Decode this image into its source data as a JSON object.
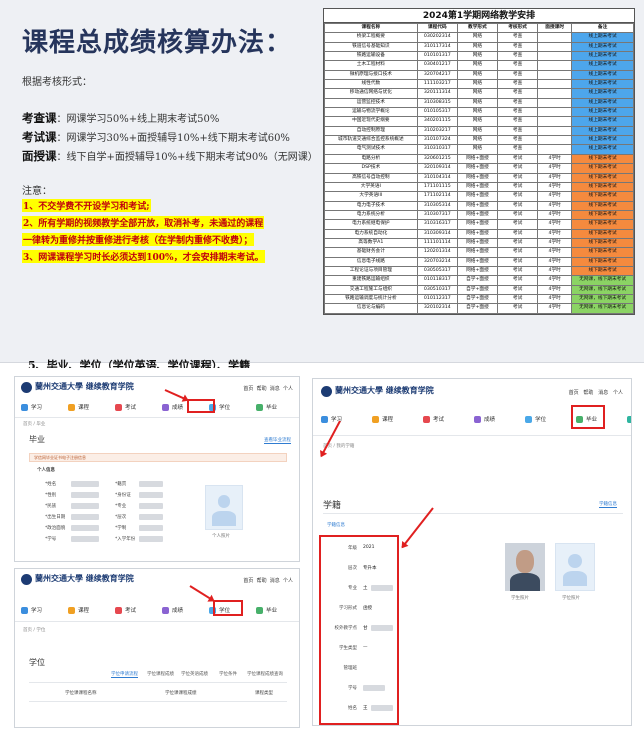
{
  "slide": {
    "title": "课程总成绩核算办法：",
    "subtitle": "根据考核形式：",
    "rules": [
      {
        "term": "考查课",
        "text": "：网课学习50%+线上期末考试50%"
      },
      {
        "term": "考试课",
        "text": "：网课学习30%+面授辅导10%+线下期末考试60%"
      },
      {
        "term": "面授课",
        "text": "：线下自学+面授辅导10%+线下期末考试90%（无网课）"
      }
    ],
    "note_label": "注意：",
    "highlights": [
      "1、不交学费不开设学习和考试;",
      "2、所有学期的视频教学全部开放，取消补考，未通过的课程",
      "一律转为重修并按重修进行考核（在学制内重修不收费）；",
      "3、网课课程学习时长必须达到100%，才会安排期末考试。"
    ]
  },
  "table": {
    "title": "2024第1学期网络教学安排",
    "headers": [
      "课程名称",
      "课程代码",
      "教学形式",
      "考核形式",
      "面授课时",
      "备注"
    ],
    "rows": [
      [
        "桥梁工程概要",
        "030202314",
        "网络",
        "考查",
        "",
        "线上期末考试",
        "blue"
      ],
      [
        "铁道信号基础知识",
        "310117314",
        "网络",
        "考查",
        "",
        "线上期末考试",
        "blue"
      ],
      [
        "铁路运输设备",
        "010101317",
        "网络",
        "考查",
        "",
        "线上期末考试",
        "blue"
      ],
      [
        "土木工程材料",
        "030401217",
        "网络",
        "考查",
        "",
        "线上期末考试",
        "blue"
      ],
      [
        "微机原理与接口技术",
        "320704217",
        "网络",
        "考查",
        "",
        "线上期末考试",
        "blue"
      ],
      [
        "线性代数",
        "111103217",
        "网络",
        "考查",
        "",
        "线上期末考试",
        "blue"
      ],
      [
        "移动通信网络与优化",
        "320111314",
        "网络",
        "考查",
        "",
        "线上期末考试",
        "blue"
      ],
      [
        "运营监控技术",
        "310308315",
        "网络",
        "考查",
        "",
        "线上期末考试",
        "blue"
      ],
      [
        "运输与物流学概论",
        "010105317",
        "网络",
        "考查",
        "",
        "线上期末考试",
        "blue"
      ],
      [
        "中国近现代史纲要",
        "340201115",
        "网络",
        "考查",
        "",
        "线上期末考试",
        "blue"
      ],
      [
        "自动控制原理",
        "310203217",
        "网络",
        "考查",
        "",
        "线上期末考试",
        "blue"
      ],
      [
        "城市轨道交通综合监控系统概述",
        "310107324",
        "网络",
        "考查",
        "",
        "线上期末考试",
        "blue"
      ],
      [
        "电气测试技术",
        "310310317",
        "网络",
        "考查",
        "",
        "线上期末考试",
        "blue"
      ],
      [
        "电路分析",
        "320601215",
        "网络+面授",
        "考试",
        "4学时",
        "线下期末考试",
        "orange"
      ],
      [
        "DSP技术",
        "320109314",
        "网络+面授",
        "考试",
        "4学时",
        "线下期末考试",
        "orange"
      ],
      [
        "高铁信号自动控制",
        "310104314",
        "网络+面授",
        "考试",
        "4学时",
        "线下期末考试",
        "orange"
      ],
      [
        "大学英语I",
        "171101115",
        "网络+面授",
        "考试",
        "4学时",
        "线下期末考试",
        "orange"
      ],
      [
        "大学英语III",
        "171102114",
        "网络+面授",
        "考试",
        "4学时",
        "线下期末考试",
        "orange"
      ],
      [
        "电力电子技术",
        "310305314",
        "网络+面授",
        "考试",
        "4学时",
        "线下期末考试",
        "orange"
      ],
      [
        "电力系统分析",
        "310307317",
        "网络+面授",
        "考试",
        "4学时",
        "线下期末考试",
        "orange"
      ],
      [
        "电力系统继电保护",
        "310316317",
        "网络+面授",
        "考试",
        "4学时",
        "线下期末考试",
        "orange"
      ],
      [
        "电力系统自动化",
        "310309314",
        "网络+面授",
        "考试",
        "4学时",
        "线下期末考试",
        "orange"
      ],
      [
        "高等数学A1",
        "111101114",
        "网络+面授",
        "考试",
        "4学时",
        "线下期末考试",
        "orange"
      ],
      [
        "基础财务会计",
        "120201314",
        "网络+面授",
        "考试",
        "4学时",
        "线下期末考试",
        "orange"
      ],
      [
        "信息电子线路",
        "320703214",
        "网络+面授",
        "考试",
        "4学时",
        "线下期末考试",
        "orange"
      ],
      [
        "工程论证与项目管理",
        "030505317",
        "网络+面授",
        "考试",
        "4学时",
        "线下期末考试",
        "orange"
      ],
      [
        "重建铁路运输组织",
        "010118317",
        "自学+面授",
        "考试",
        "4学时",
        "无网课，线下期末考试",
        "green"
      ],
      [
        "交通工程施工与组织",
        "030510317",
        "自学+面授",
        "考试",
        "4学时",
        "无网课，线下期末考试",
        "green"
      ],
      [
        "铁路运输调度与统计分析",
        "010112317",
        "自学+面授",
        "考试",
        "4学时",
        "无网课，线下期末考试",
        "green"
      ],
      [
        "信息论与编码",
        "320102314",
        "自学+面授",
        "考试",
        "4学时",
        "无网课，线下期末考试",
        "green"
      ]
    ]
  },
  "section5": {
    "title": "5、毕业、学位（学位英语、学位课程）、学籍"
  },
  "colors": {
    "blue": "#4da6ec",
    "orange": "#f58a3e",
    "green": "#8bd364",
    "navy": "#26355c",
    "highlight_red": "#c0000e"
  },
  "portal": {
    "logo_text": "蘭州交通大學 继续教育学院",
    "top_links": [
      "首页",
      "帮助",
      "消息",
      "个人"
    ],
    "nav": [
      "学习",
      "课程",
      "考试",
      "成绩",
      "学位",
      "毕业",
      "学籍"
    ],
    "nav_colors": [
      "#3b8ede",
      "#f0a023",
      "#e6484f",
      "#8a63d2",
      "#4aa8e8",
      "#47b06a",
      "#2fb5a0"
    ],
    "grad": {
      "crumb": "首页 / 毕业",
      "title": "毕业",
      "link": "查看毕业流程",
      "banner": "学信网毕业证书电子注册信息",
      "section": "个人信息",
      "labels": [
        "*姓名",
        "*性别",
        "*民族",
        "*出生日期",
        "*政治面貌",
        "*学号"
      ],
      "labels_right": [
        "*籍贯",
        "*身份证",
        "*专业",
        "*层次",
        "*学制",
        "*入学年份"
      ],
      "photo_caption": "个人照片"
    },
    "degree": {
      "crumb": "首页 / 学位",
      "title": "学位",
      "tabs": [
        "学位申请流程",
        "学位课程成绩",
        "学位英语成绩",
        "学位条件",
        "学位课程成绩查询"
      ],
      "cols": [
        "学位课课程名称",
        "学位课课程成绩",
        "课程类型"
      ]
    },
    "record": {
      "crumb": "首页 / 我的学籍",
      "title": "学籍",
      "link": "学籍信息",
      "section": "学籍信息",
      "fields": [
        {
          "label": "年级",
          "value": "2021"
        },
        {
          "label": "层次",
          "value": "专升本"
        },
        {
          "label": "专业",
          "value": "土"
        },
        {
          "label": "学习形式",
          "value": "函授"
        },
        {
          "label": "校外教学点",
          "value": "甘"
        },
        {
          "label": "学生类型",
          "value": "—"
        },
        {
          "label": "管理班",
          "value": ""
        },
        {
          "label": "学号",
          "value": ""
        },
        {
          "label": "姓名",
          "value": "王"
        }
      ],
      "photo_caption_1": "学生照片",
      "photo_caption_2": "学位照片"
    }
  }
}
